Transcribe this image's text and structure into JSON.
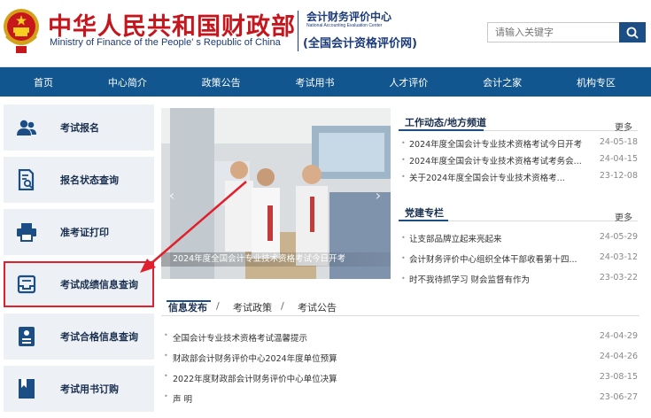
{
  "header": {
    "cn_title": "中华人民共和国财政部",
    "en_title": "Ministry of Finance of the People' s Republic of China",
    "center_cn": "会计财务评价中心",
    "center_en": "National Accounting Evaluation Center",
    "center_sub": "(全国会计资格评价网)",
    "search_placeholder": "请输入关键字"
  },
  "nav": [
    "首页",
    "中心简介",
    "政策公告",
    "考试用书",
    "人才评价",
    "会计之家",
    "机构专区"
  ],
  "sidebar": [
    {
      "label": "考试报名",
      "icon": "users-icon"
    },
    {
      "label": "报名状态查询",
      "icon": "document-search-icon"
    },
    {
      "label": "准考证打印",
      "icon": "printer-icon"
    },
    {
      "label": "考试成绩信息查询",
      "icon": "inbox-icon"
    },
    {
      "label": "考试合格信息查询",
      "icon": "certificate-icon"
    },
    {
      "label": "考试用书订购",
      "icon": "book-icon"
    }
  ],
  "hero": {
    "caption": "2024年度全国会计专业技术资格考试今日开考"
  },
  "work_news": {
    "title": "工作动态/地方频道",
    "more": "更多",
    "items": [
      {
        "text": "2024年度全国会计专业技术资格考试今日开考",
        "date": "24-05-18"
      },
      {
        "text": "2024年度全国会计专业技术资格考试考务会...",
        "date": "24-04-15"
      },
      {
        "text": "关于2024年度全国会计专业技术资格考...",
        "date": "23-12-08"
      }
    ]
  },
  "party": {
    "title": "党建专栏",
    "more": "更多",
    "items": [
      {
        "text": "让支部品牌立起来亮起来",
        "date": "24-05-29"
      },
      {
        "text": "会计财务评价中心组织全体干部收看第十四...",
        "date": "24-03-12"
      },
      {
        "text": "时不我待抓学习 财会监督有作为",
        "date": "23-03-22"
      }
    ]
  },
  "info": {
    "tabs": [
      "信息发布",
      "考试政策",
      "考试公告"
    ],
    "separator": "/",
    "items": [
      {
        "text": "全国会计专业技术资格考试温馨提示",
        "date": "24-04-29"
      },
      {
        "text": "财政部会计财务评价中心2024年度单位预算",
        "date": "24-04-26"
      },
      {
        "text": "2022年度财政部会计财务评价中心单位决算",
        "date": "23-08-15"
      },
      {
        "text": "声 明",
        "date": "23-06-27"
      }
    ]
  },
  "colors": {
    "brand_red": "#c4161c",
    "nav_blue": "#12568f",
    "sidebar_bg": "#edf0f4",
    "highlight": "#e0212d"
  }
}
